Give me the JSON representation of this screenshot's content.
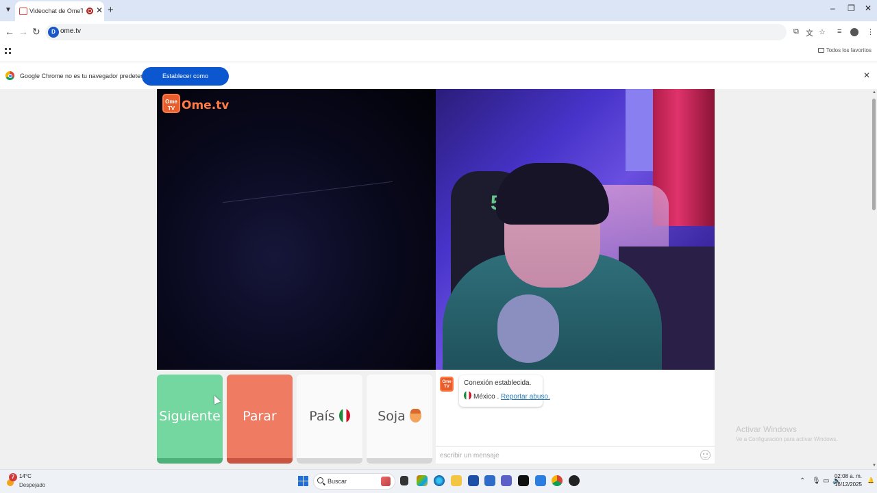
{
  "browser": {
    "tab_title": "Videochat de OmeTV: una",
    "url": "ome.tv",
    "site_icon_letter": "D",
    "bookmarks_folder": "Todos los favoritos",
    "window_controls": {
      "minimize": "–",
      "maximize": "❐",
      "close": "✕"
    }
  },
  "infobar": {
    "message": "Google Chrome no es tu navegador predeterminado",
    "button": "Establecer como predeterminado",
    "close": "✕"
  },
  "page": {
    "logo_badge": "Ome TV",
    "logo_text": "Ome.tv",
    "controls": {
      "next": "Siguiente",
      "stop": "Parar",
      "country": "País",
      "gender": "Soja"
    },
    "chat": {
      "avatar": "Ome TV",
      "status": "Conexión establecida.",
      "country": "México",
      "separator": " . ",
      "report": "Reportar abuso.",
      "input_placeholder": "escribir un mensaje"
    },
    "watermark": {
      "title": "Activar Windows",
      "subtitle": "Ve a Configuración para activar Windows."
    }
  },
  "taskbar": {
    "weather_badge": "7",
    "temperature": "14°C",
    "weather": "Despejado",
    "search_label": "Buscar",
    "time": "02:08 a. m.",
    "date": "16/12/2025"
  }
}
